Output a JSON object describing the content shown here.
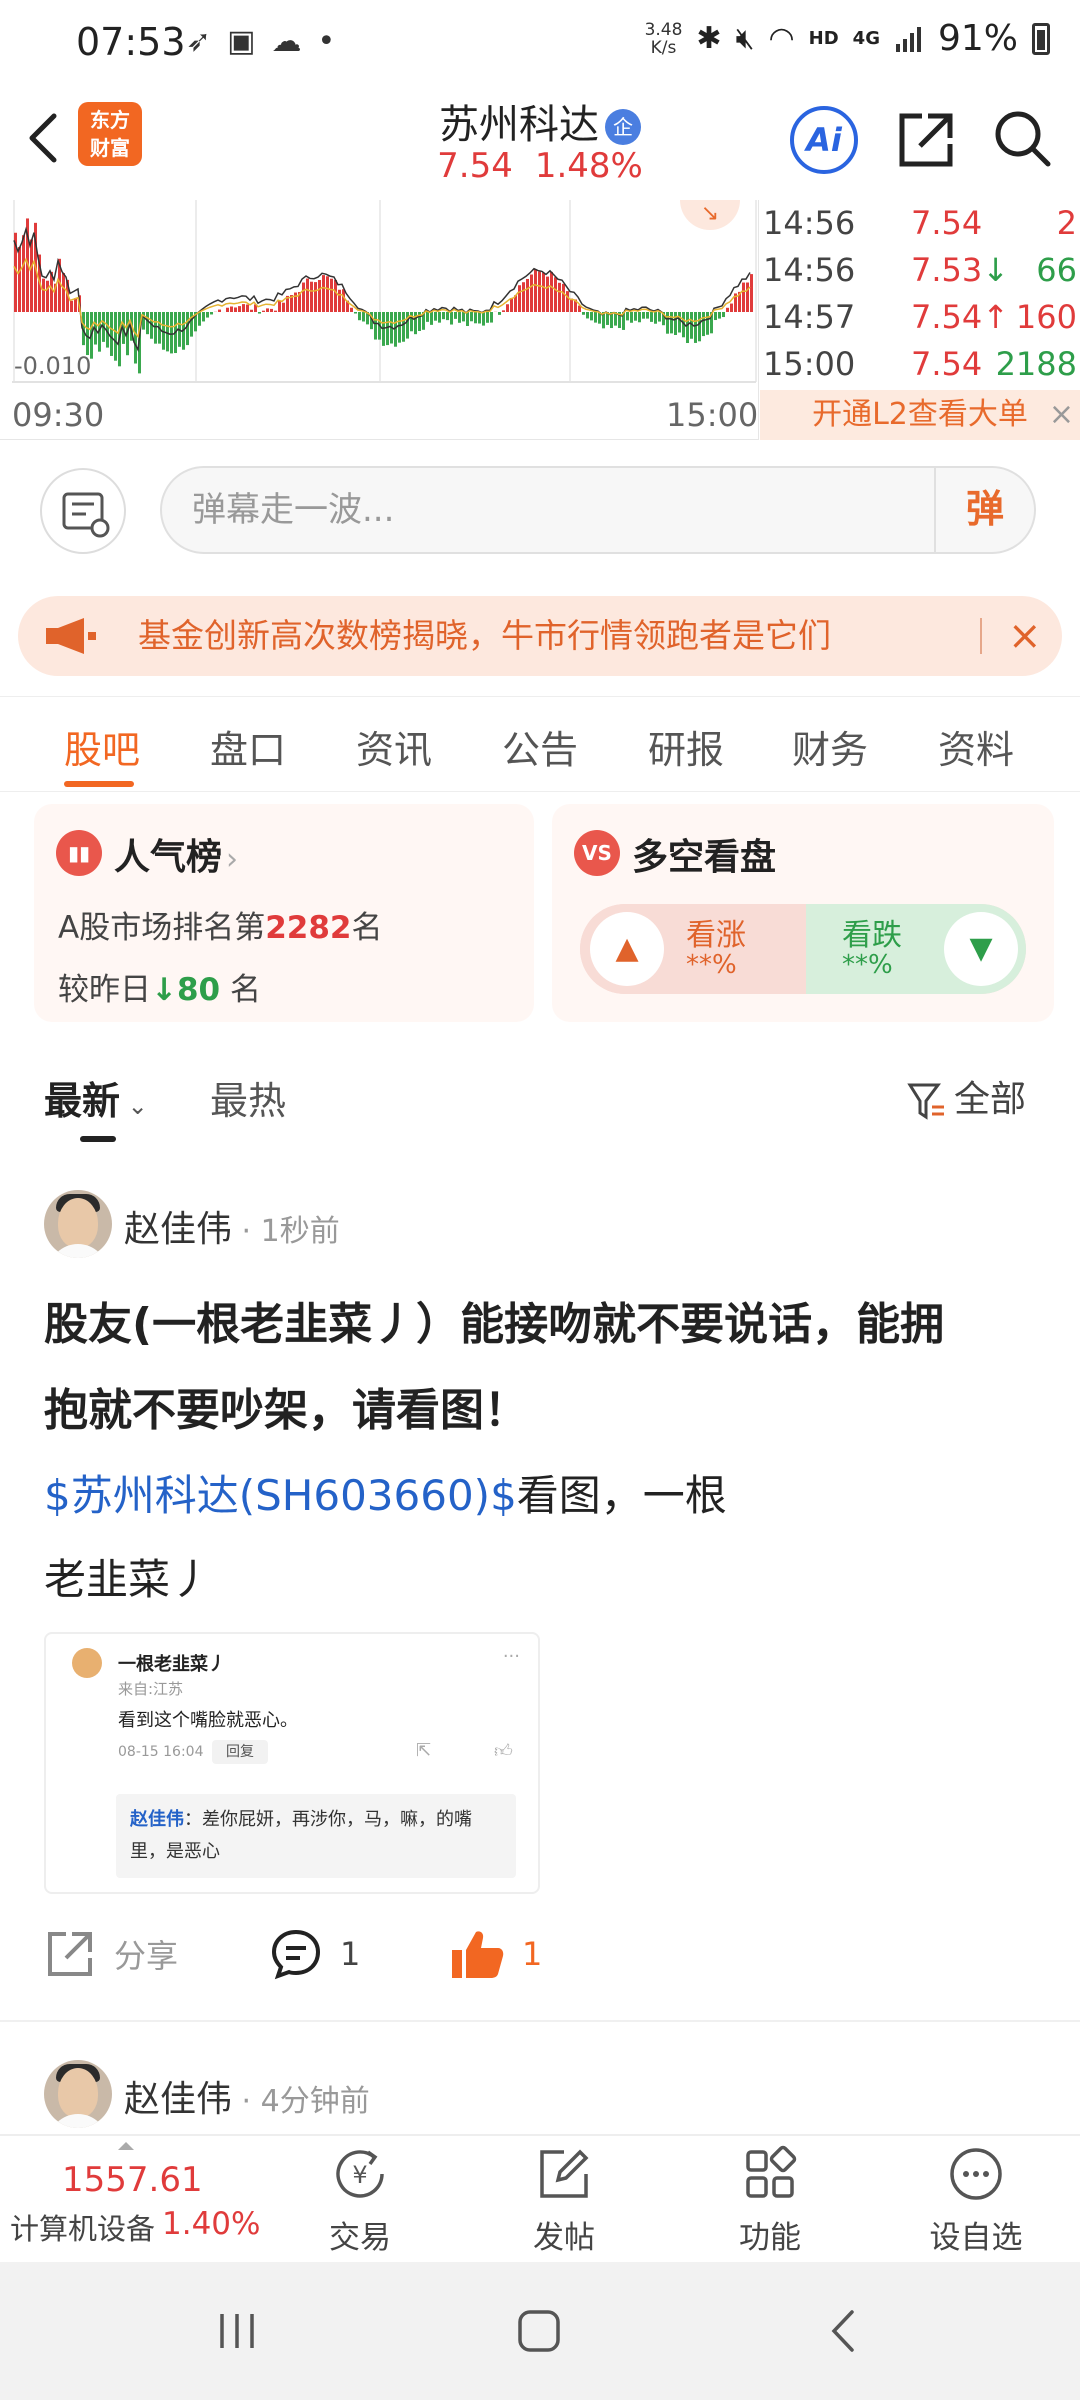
{
  "status_bar": {
    "time": "07:53",
    "speed": "3.48\nK/s",
    "speed_top": "3.48",
    "speed_bottom": "K/s",
    "network": "4G",
    "hd": "HD",
    "battery": "91%"
  },
  "header": {
    "logo_line1": "东方",
    "logo_line2": "财富",
    "stock_name": "苏州科达",
    "badge": "企",
    "price": "7.54",
    "change_pct": "1.48%",
    "ai_label": "Ai"
  },
  "chart": {
    "time_start": "09:30",
    "time_end": "15:00",
    "y_label": "-0.010",
    "upward_tag": "↘",
    "ticks": [
      {
        "time": "14:56",
        "price": "7.54",
        "arrow": "",
        "volume": "2",
        "color": "#e03b3b"
      },
      {
        "time": "14:56",
        "price": "7.53",
        "arrow": "↓",
        "volume": "66",
        "color": "#2e9e4a"
      },
      {
        "time": "14:57",
        "price": "7.54",
        "arrow": "↑",
        "volume": "160",
        "color": "#e03b3b"
      },
      {
        "time": "15:00",
        "price": "7.54",
        "arrow": "",
        "volume": "2188",
        "color": "#2e9e4a"
      }
    ],
    "l2_label": "开通L2查看大单",
    "l2_close": "×"
  },
  "comment_bar": {
    "placeholder": "弹幕走一波...",
    "dan_label": "弹"
  },
  "banner": {
    "text": "基金创新高次数榜揭晓，牛市行情领跑者是它们",
    "close": "×"
  },
  "tabs": [
    "股吧",
    "盘口",
    "资讯",
    "公告",
    "研报",
    "财务",
    "资料"
  ],
  "cards": {
    "popularity": {
      "title": "人气榜",
      "chev": "›",
      "rank_prefix": "A股市场排名第",
      "rank": "2282",
      "rank_suffix": "名",
      "vs_prefix": "较昨日",
      "vs_arrow": "↓",
      "vs_value": "80",
      "vs_suffix": " 名"
    },
    "sentiment": {
      "title": "多空看盘",
      "icon": "VS",
      "up_label": "看涨",
      "up_pct": "**%",
      "down_label": "看跌",
      "down_pct": "**%"
    }
  },
  "sort_bar": {
    "latest": "最新",
    "hot": "最热",
    "filter": "全部"
  },
  "posts": [
    {
      "author": "赵佳伟",
      "ago": " · 1秒前",
      "title_line1": "股友(一根老韭菜丿）能接吻就不要说话，能拥",
      "title_line2": "抱就不要吵架，请看图！",
      "link": "$苏州科达(SH603660)$",
      "body_after_link": "看图，一根",
      "body_line2": "老韭菜丿",
      "screenshot": {
        "name": "一根老韭菜丿",
        "more": "···",
        "location": "来自:江苏",
        "text": "看到这个嘴脸就恶心。",
        "date": "08-15 16:04",
        "reply": "回复",
        "quote_name": "赵佳伟",
        "quote_text": "：差你屁妍，再涉你，马，嘛，的嘴里，是恶心"
      },
      "share_label": "分享",
      "comment_count": "1",
      "like_count": "1"
    },
    {
      "author": "赵佳伟",
      "ago": " · 4分钟前"
    }
  ],
  "bottom_nav": {
    "index_value": "1557.61",
    "index_name": "计算机设备",
    "index_pct": "1.40%",
    "items": [
      "交易",
      "发帖",
      "功能",
      "设自选"
    ]
  },
  "colors": {
    "brand": "#f26722",
    "up": "#e03b3b",
    "down": "#2e9e4a",
    "link": "#2462c8"
  }
}
